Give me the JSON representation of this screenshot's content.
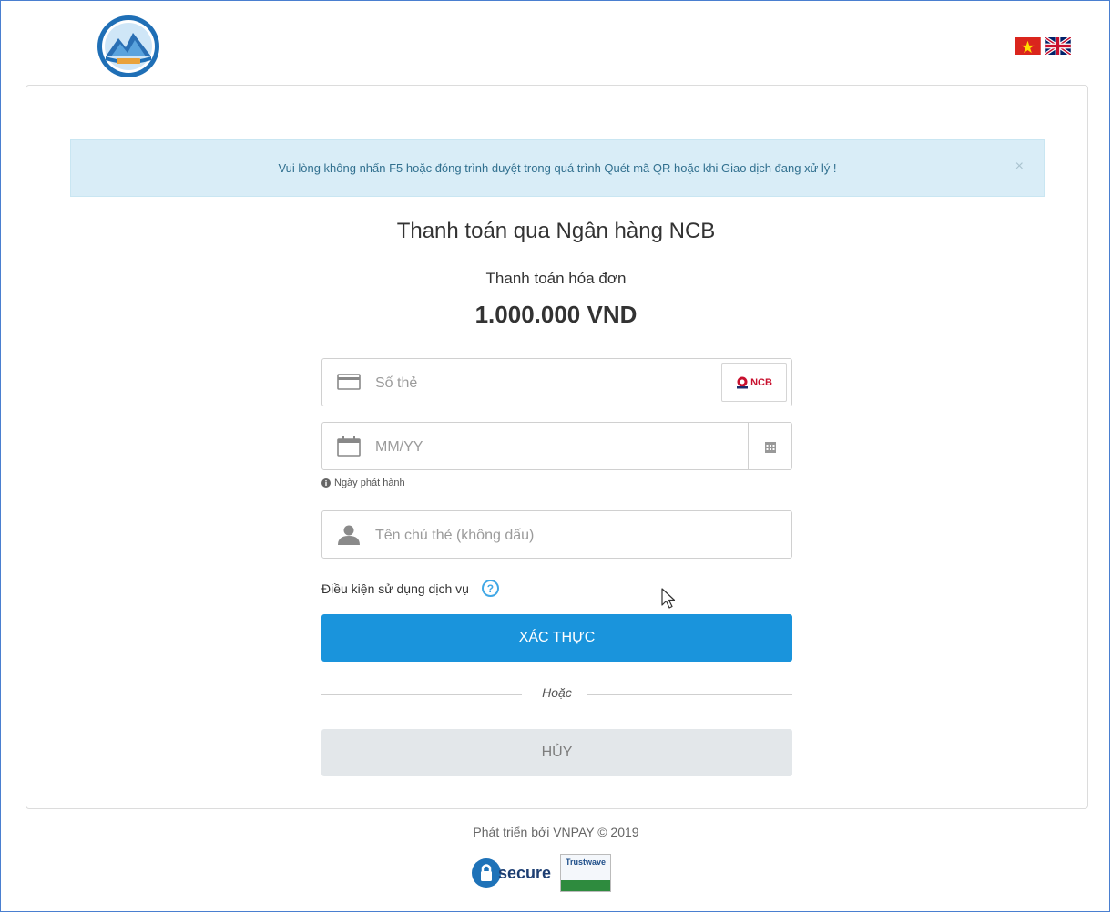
{
  "header": {
    "logo_icon": "city-emblem-logo",
    "languages": [
      {
        "code": "vi",
        "icon": "vietnam-flag-icon"
      },
      {
        "code": "en",
        "icon": "uk-flag-icon"
      }
    ]
  },
  "alert": {
    "message": "Vui lòng không nhấn F5 hoặc đóng trình duyệt trong quá trình Quét mã QR hoặc khi Giao dịch đang xử lý !",
    "close_label": "×"
  },
  "payment": {
    "title": "Thanh toán qua Ngân hàng NCB",
    "subtitle": "Thanh toán hóa đơn",
    "amount": "1.000.000 VND"
  },
  "form": {
    "card_number": {
      "placeholder": "Số thẻ",
      "value": "",
      "bank_logo_text": "NCB"
    },
    "issue_date": {
      "placeholder": "MM/YY",
      "value": "",
      "hint": "Ngày phát hành"
    },
    "holder_name": {
      "placeholder": "Tên chủ thẻ (không dấu)",
      "value": ""
    },
    "terms_label": "Điều kiện sử dụng dịch vụ",
    "confirm_label": "XÁC THỰC",
    "or_label": "Hoặc",
    "cancel_label": "HỦY"
  },
  "footer": {
    "credit": "Phát triển bởi VNPAY © 2019",
    "badges": [
      {
        "icon": "globalsign-secure-seal-icon",
        "text": "secure"
      },
      {
        "icon": "trustwave-trusted-commerce-seal-icon",
        "text": "Trustwave"
      }
    ]
  },
  "colors": {
    "primary": "#1a94dc",
    "alert_bg": "#d9edf7",
    "alert_text": "#31708f",
    "cancel_bg": "#e3e7ea",
    "frame_border": "#4a7fd0"
  }
}
